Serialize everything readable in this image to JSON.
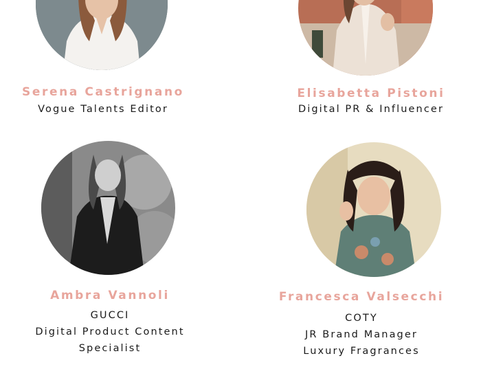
{
  "colors": {
    "name_accent": "#e8a59c",
    "text": "#1a1a1a",
    "background": "#ffffff"
  },
  "profiles": [
    {
      "name": "Serena Castrignano",
      "lines": [
        "Vogue Talents Editor"
      ],
      "photo_icon": "portrait-photo"
    },
    {
      "name": "Elisabetta Pistoni",
      "lines": [
        "Digital PR & Influencer"
      ],
      "photo_icon": "portrait-photo"
    },
    {
      "name": "Ambra Vannoli",
      "lines": [
        "GUCCI",
        "Digital Product Content",
        "Specialist"
      ],
      "photo_icon": "portrait-photo"
    },
    {
      "name": "Francesca Valsecchi",
      "lines": [
        "COTY",
        "JR Brand Manager",
        "Luxury Fragrances"
      ],
      "photo_icon": "portrait-photo"
    }
  ]
}
